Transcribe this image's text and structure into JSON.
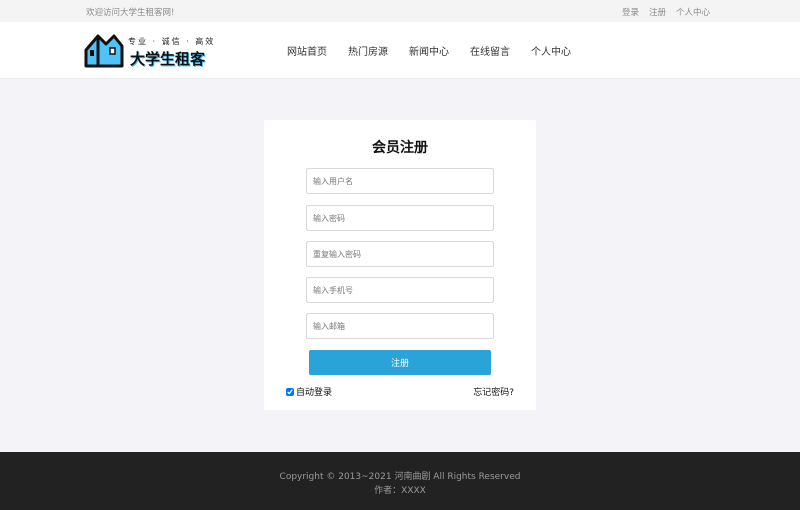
{
  "topbar": {
    "welcome": "欢迎访问大学生租客网!",
    "login": "登录",
    "register": "注册",
    "personal": "个人中心"
  },
  "header": {
    "logo_slogan": "专业 · 诚信 · 高效",
    "logo_name": "大学生租客",
    "nav": [
      "网站首页",
      "热门房源",
      "新闻中心",
      "在线留言",
      "个人中心"
    ],
    "logo_accent": "#4fc3f7"
  },
  "form": {
    "title": "会员注册",
    "username_placeholder": "输入用户名",
    "password_placeholder": "输入密码",
    "confirm_placeholder": "重复输入密码",
    "phone_placeholder": "输入手机号",
    "email_placeholder": "输入邮箱",
    "submit": "注册",
    "auto_login": "自动登录",
    "auto_login_checked": true,
    "forgot": "忘记密码?",
    "button_color": "#2aa3d8"
  },
  "footer": {
    "copyright": "Copyright © 2013~2021 河南曲剧 All Rights Reserved",
    "author": "作者：XXXX"
  }
}
